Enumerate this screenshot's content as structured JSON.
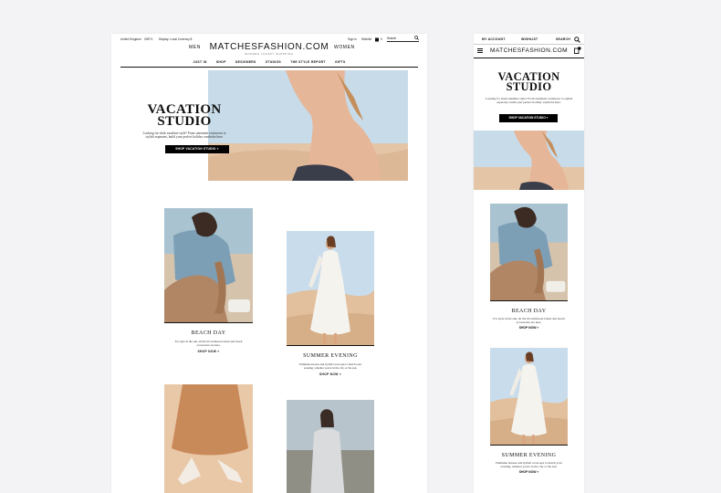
{
  "desktop": {
    "utility": {
      "country": "United Kingdom",
      "currency": "GBP £",
      "display_currency": "Display: Local Currency $",
      "signin": "Sign in",
      "wishlist": "Wishlist",
      "bag_count": "0",
      "search_placeholder": "Search"
    },
    "header": {
      "logo": "MATCHESFASHION.COM",
      "tagline": "MODERN LUXURY SHOPPING",
      "men": "MEN",
      "women": "WOMEN"
    },
    "nav": [
      "JUST IN",
      "SHOP",
      "DESIGNERS",
      "STUDIOS",
      "THE STYLE REPORT",
      "GIFTS"
    ],
    "hero": {
      "title_line1": "VACATION",
      "title_line2": "STUDIO",
      "copy": "Looking for sleek sunshine style? From statement swimwear to stylish separates, build your perfect holiday wardrobe here.",
      "button": "SHOP VACATION STUDIO »"
    },
    "cards": [
      {
        "title": "BEACH DAY",
        "copy": "For style in the sun, all the hit swimwear labels and beach accessories are here.",
        "link": "SHOP NOW »"
      },
      {
        "title": "SUMMER EVENING",
        "copy": "Feminine dresses and stylish cover-ups to match your evening, whether you're in the city or the sun.",
        "link": "SHOP NOW »"
      }
    ]
  },
  "mobile": {
    "top": {
      "account": "MY ACCOUNT",
      "wishlist": "WISHLIST",
      "search": "SEARCH"
    },
    "logo": "MATCHESFASHION.COM",
    "bag_count": "0",
    "hero": {
      "title_line1": "VACATION",
      "title_line2": "STUDIO",
      "copy": "Looking for sleek sunshine style? From statement swimwear to stylish separates, build your perfect holiday wardrobe here.",
      "button": "SHOP VACATION STUDIO »"
    },
    "cards": [
      {
        "title": "BEACH DAY",
        "copy": "For style in the sun, all the hit swimwear labels and beach accessories are here.",
        "link": "SHOP NOW »"
      },
      {
        "title": "SUMMER EVENING",
        "copy": "Feminine dresses and stylish cover-ups to match your evening, whether you're in the city or the sun.",
        "link": "SHOP NOW »"
      }
    ]
  },
  "colors": {
    "background": "#f3f2f4",
    "sky": "#bfd6e6",
    "sand": "#e8c9a9",
    "black": "#000000"
  }
}
